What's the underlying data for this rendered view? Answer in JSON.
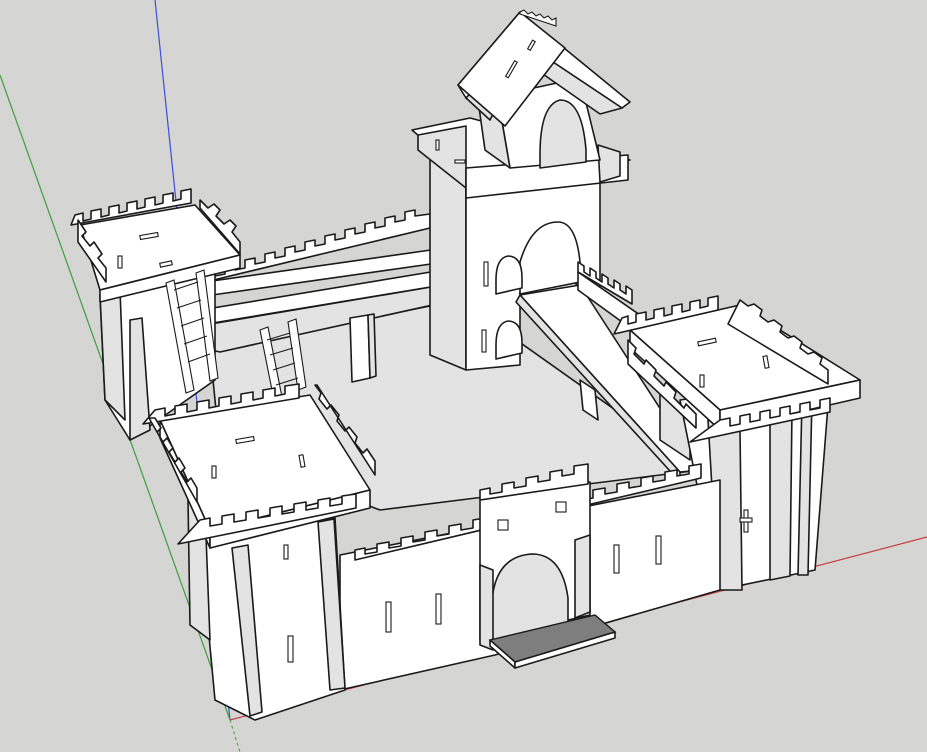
{
  "viewport": {
    "background_color": "#d5d5d3",
    "model_fill_color": "#ffffff",
    "edge_color": "#1a1a1a",
    "shaded_face_color": "#e3e3e3",
    "drawbridge_color": "#7e7e7e"
  },
  "axes": {
    "red_axis_color": "#c84040",
    "green_axis_color": "#3f9f3f",
    "blue_axis_color": "#3b4fd6"
  },
  "model": {
    "components": [
      "main-tower",
      "left-back-turret",
      "right-turret",
      "front-left-turret",
      "gatehouse",
      "front-wall",
      "right-wall",
      "back-walkway",
      "ladder-left",
      "ladder-right",
      "drawbridge"
    ]
  }
}
